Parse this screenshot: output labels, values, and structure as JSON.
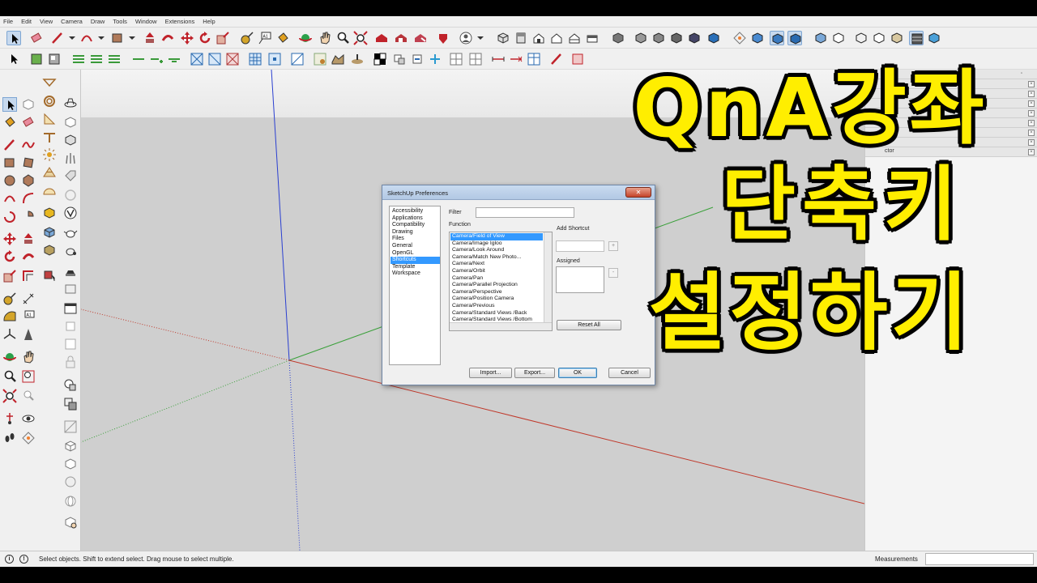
{
  "menu": [
    "File",
    "Edit",
    "View",
    "Camera",
    "Draw",
    "Tools",
    "Window",
    "Extensions",
    "Help"
  ],
  "overlay": {
    "line1": "QnA강좌",
    "line2": "단축키",
    "line3": "설정하기"
  },
  "dialog": {
    "title": "SketchUp Preferences",
    "close": "✕",
    "categories": [
      "Accessibility",
      "Applications",
      "Compatibility",
      "Drawing",
      "Files",
      "General",
      "OpenGL",
      "Shortcuts",
      "Template",
      "Workspace"
    ],
    "selected_category": "Shortcuts",
    "filter_label": "Filter",
    "filter_value": "",
    "function_label": "Function",
    "functions": [
      "Camera/Field of View",
      "Camera/Image Igloo",
      "Camera/Look Around",
      "Camera/Match New Photo...",
      "Camera/Next",
      "Camera/Orbit",
      "Camera/Pan",
      "Camera/Parallel Projection",
      "Camera/Perspective",
      "Camera/Position Camera",
      "Camera/Previous",
      "Camera/Standard Views /Back",
      "Camera/Standard Views /Bottom"
    ],
    "selected_function": "Camera/Field of View",
    "add_shortcut_label": "Add Shortcut",
    "assigned_label": "Assigned",
    "plus": "+",
    "minus": "-",
    "reset_all": "Reset All",
    "import": "Import...",
    "export": "Export...",
    "ok": "OK",
    "cancel": "Cancel"
  },
  "tray": {
    "partial_label": "ctor"
  },
  "status": {
    "message": "Select objects. Shift to extend select. Drag mouse to select multiple.",
    "measurements_label": "Measurements",
    "measurements_value": ""
  },
  "colors": {
    "overlay_text": "#ffee00",
    "selection": "#3399ff",
    "red_axis": "#c0392b",
    "green_axis": "#3aa03a",
    "blue_axis": "#2a3fd0"
  }
}
